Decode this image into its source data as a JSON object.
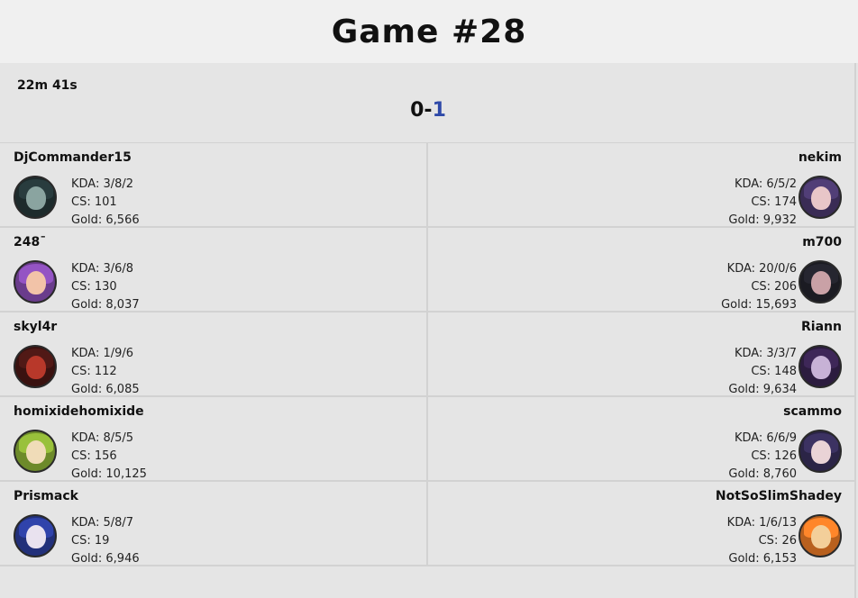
{
  "header": {
    "title": "Game #28"
  },
  "match": {
    "duration": "22m 41s",
    "score_left": "0",
    "score_sep": "-",
    "score_right": "1"
  },
  "colors": {
    "blue_score": "#2e49a8",
    "background": "#e5e5e5",
    "header_bg": "#f0f0f0"
  },
  "rows": [
    {
      "left": {
        "name": "DjCommander15",
        "kda": "KDA: 3/8/2",
        "cs": "CS: 101",
        "gold": "Gold: 6,566",
        "icon": "champion-avatar-dark-armored",
        "colors": [
          "#1d2b2c",
          "#8aa4a0"
        ]
      },
      "right": {
        "name": "nekim",
        "kda": "KDA: 6/5/2",
        "cs": "CS: 174",
        "gold": "Gold: 9,932",
        "icon": "champion-avatar-purple-hair",
        "colors": [
          "#3a2c55",
          "#e8c6c8"
        ]
      }
    },
    {
      "left": {
        "name": "248¯",
        "kda": "KDA: 3/6/8",
        "cs": "CS: 130",
        "gold": "Gold: 8,037",
        "icon": "champion-avatar-pink-hair",
        "colors": [
          "#6a3c8c",
          "#f2c3a8"
        ]
      },
      "right": {
        "name": "m700",
        "kda": "KDA: 20/0/6",
        "cs": "CS: 206",
        "gold": "Gold: 15,693",
        "icon": "champion-avatar-dark-cat",
        "colors": [
          "#1b1b22",
          "#c9a1a6"
        ]
      }
    },
    {
      "left": {
        "name": "skyl4r",
        "kda": "KDA: 1/9/6",
        "cs": "CS: 112",
        "gold": "Gold: 6,085",
        "icon": "champion-avatar-red-demon",
        "colors": [
          "#3a1210",
          "#b8382a"
        ]
      },
      "right": {
        "name": "Riann",
        "kda": "KDA: 3/3/7",
        "cs": "CS: 148",
        "gold": "Gold: 9,634",
        "icon": "champion-avatar-purple-mage",
        "colors": [
          "#2c1c3f",
          "#c7b2d6"
        ]
      }
    },
    {
      "left": {
        "name": "homixidehomixide",
        "kda": "KDA: 8/5/5",
        "cs": "CS: 156",
        "gold": "Gold: 10,125",
        "icon": "champion-avatar-green-dryad",
        "colors": [
          "#6d8a2a",
          "#f0dcb8"
        ]
      },
      "right": {
        "name": "scammo",
        "kda": "KDA: 6/6/9",
        "cs": "CS: 126",
        "gold": "Gold: 8,760",
        "icon": "champion-avatar-violet-hood",
        "colors": [
          "#2b2446",
          "#e9d3d6"
        ]
      }
    },
    {
      "left": {
        "name": "Prismack",
        "kda": "KDA: 5/8/7",
        "cs": "CS: 19",
        "gold": "Gold: 6,946",
        "icon": "champion-avatar-blue-white-hair",
        "colors": [
          "#22307a",
          "#e9e2ef"
        ]
      },
      "right": {
        "name": "NotSoSlimShadey",
        "kda": "KDA: 1/6/13",
        "cs": "CS: 26",
        "gold": "Gold: 6,153",
        "icon": "champion-avatar-orange-hair",
        "colors": [
          "#b8601e",
          "#f3cf9a"
        ]
      }
    }
  ]
}
